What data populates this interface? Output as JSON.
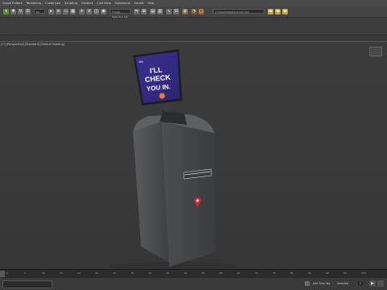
{
  "menu": [
    "Graph Editors",
    "Rendering",
    "Customize",
    "Scripting",
    "Content",
    "Civil View",
    "Substance",
    "Arnold",
    "Help"
  ],
  "toolbar": {
    "selection_filter": "All",
    "selection_set": "Create Selection Set",
    "workspace": "C:\\Users\\Desktop\\kiosk.max"
  },
  "viewport": {
    "label": "[+] [Perspective] [Standard] [Default Shading]",
    "screen_text": [
      "I'LL",
      "CHECK",
      "YOU IN."
    ],
    "screen_brand": "offla"
  },
  "timeline": {
    "ticks": [
      "0",
      "5",
      "10",
      "15",
      "20",
      "25",
      "30",
      "35",
      "40",
      "45",
      "50",
      "55",
      "60",
      "65",
      "70",
      "75",
      "80",
      "85",
      "90",
      "95",
      "100"
    ]
  },
  "status": {
    "autokey": "Selected",
    "set_key": "Add Time Tag",
    "frame": "0"
  },
  "colors": {
    "screen": "#3a2f8a",
    "pin": "#d8282b",
    "body": "#4b4c4e"
  }
}
